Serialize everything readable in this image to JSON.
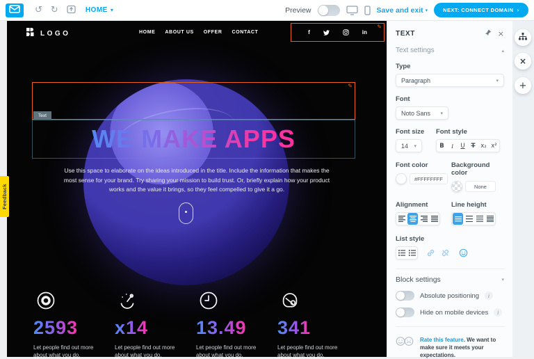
{
  "toolbar": {
    "page_name": "HOME",
    "preview_label": "Preview",
    "save_exit_label": "Save and exit",
    "next_button_label": "NEXT: CONNECT DOMAIN"
  },
  "feedback_tab_label": "Feedback",
  "icons": {
    "undo": "↺",
    "redo": "↻",
    "chevron_down": "▾",
    "chevron_up": "▴",
    "pencil": "✎",
    "close": "×",
    "plus": "+",
    "info": "i",
    "next_arrow": "›"
  },
  "site": {
    "logo_text": "LOGO",
    "nav": [
      "HOME",
      "ABOUT US",
      "OFFER",
      "CONTACT"
    ],
    "social": [
      "facebook",
      "twitter",
      "instagram",
      "linkedin"
    ],
    "element_tab_label": "Text",
    "heading": "WE MAKE APPS",
    "paragraph": "Use this space to elaborate on the ideas introduced in the title. Include the information that makes the most sense for your brand. Try sharing your mission to build trust. Or, briefly explain how your product works and the value it brings, so they feel compelled to give it a go.",
    "social_labels": {
      "facebook": "f",
      "linkedin": "in"
    },
    "stats": [
      {
        "icon": "record-icon",
        "value": "2593",
        "caption": "Let people find out more about what you do."
      },
      {
        "icon": "gauge-icon",
        "value": "x14",
        "caption": "Let people find out more about what you do."
      },
      {
        "icon": "clock-icon",
        "value": "13.49",
        "caption": "Let people find out more about what you do."
      },
      {
        "icon": "helmet-icon",
        "value": "341",
        "caption": "Let people find out more about what you do."
      }
    ]
  },
  "panel": {
    "title": "TEXT",
    "text_settings_label": "Text settings",
    "type_label": "Type",
    "type_value": "Paragraph",
    "font_label": "Font",
    "font_value": "Noto Sans",
    "font_size_label": "Font size",
    "font_size_value": "14",
    "font_style_label": "Font style",
    "font_style_buttons": [
      "B",
      "I",
      "U",
      "T",
      "x₂",
      "x²"
    ],
    "font_color_label": "Font color",
    "font_color_value": "#FFFFFFFF",
    "background_color_label": "Background color",
    "background_color_value": "None",
    "alignment_label": "Alignment",
    "line_height_label": "Line height",
    "list_style_label": "List style",
    "block_settings_label": "Block settings",
    "absolute_positioning_label": "Absolute positioning",
    "hide_on_mobile_label": "Hide on mobile devices",
    "rate_link_label": "Rate this feature",
    "rate_text": ". We want to make sure it meets your expectations."
  },
  "colors": {
    "accent_blue": "#00a9f0",
    "selection_orange": "#e8611f",
    "heading_gradient_start": "#5588f2",
    "heading_gradient_end": "#ff2f9e",
    "feedback_yellow": "#ffd900",
    "canvas_black": "#050505"
  }
}
